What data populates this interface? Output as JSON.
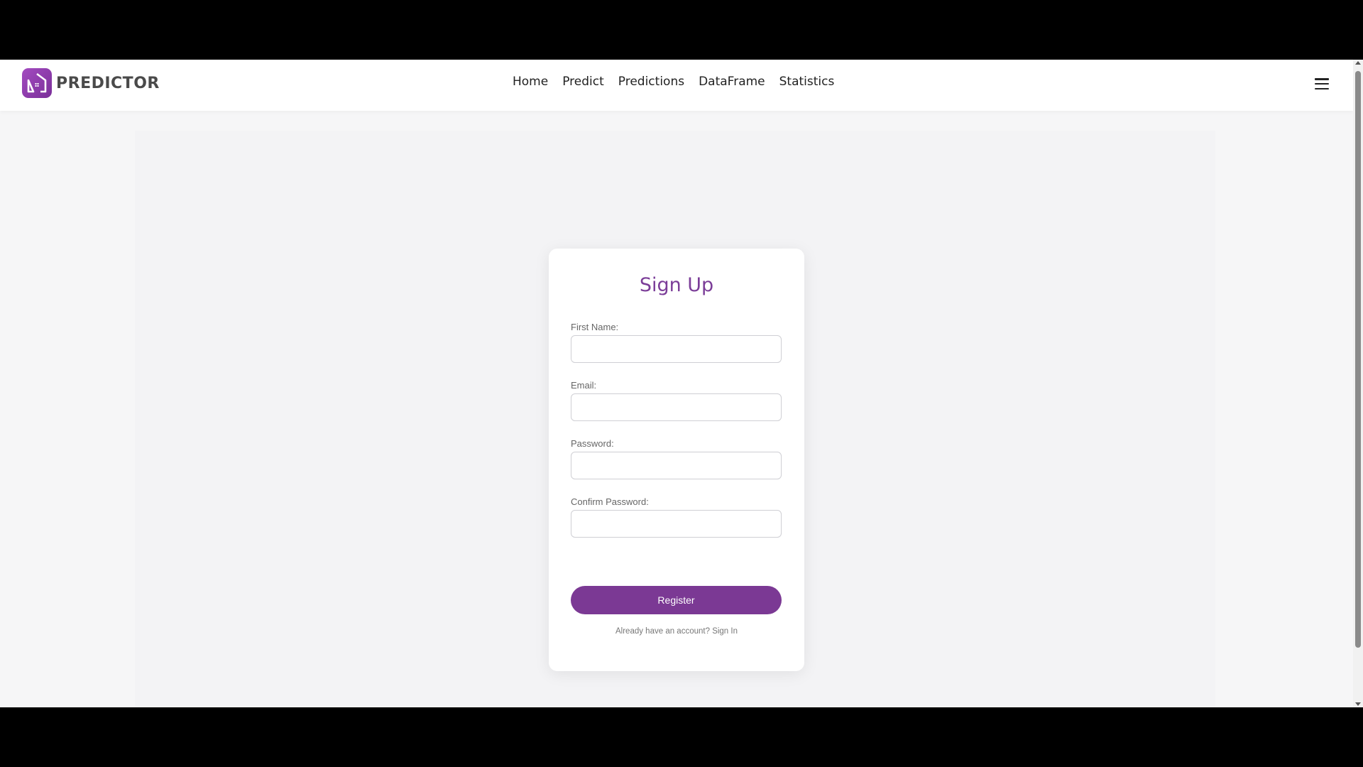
{
  "brand": {
    "name": "PREDICTOR",
    "logo_icon": "house-icon",
    "logo_color": "#8e3fae"
  },
  "nav": {
    "items": [
      {
        "label": "Home"
      },
      {
        "label": "Predict"
      },
      {
        "label": "Predictions"
      },
      {
        "label": "DataFrame"
      },
      {
        "label": "Statistics"
      }
    ],
    "menu_icon": "hamburger-icon"
  },
  "form": {
    "title": "Sign Up",
    "fields": [
      {
        "label": "First Name:",
        "value": "",
        "placeholder": ""
      },
      {
        "label": "Email:",
        "value": "",
        "placeholder": ""
      },
      {
        "label": "Password:",
        "value": "",
        "placeholder": ""
      },
      {
        "label": "Confirm Password:",
        "value": "",
        "placeholder": ""
      }
    ],
    "submit_label": "Register",
    "signin_prompt": "Already have an account?",
    "signin_link": "Sign In"
  },
  "colors": {
    "accent": "#7b3994",
    "title": "#7b3d98"
  }
}
